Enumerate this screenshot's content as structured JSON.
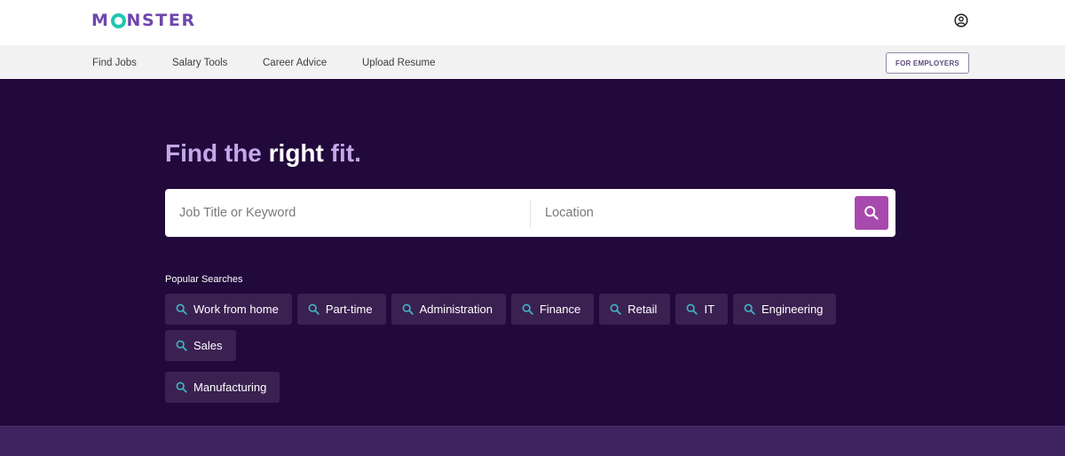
{
  "header": {
    "logo": {
      "pre": "M",
      "post": "NSTER",
      "full": "MONSTER"
    },
    "user_icon": "user-circle-icon"
  },
  "nav": {
    "items": [
      {
        "label": "Find Jobs"
      },
      {
        "label": "Salary Tools"
      },
      {
        "label": "Career Advice"
      },
      {
        "label": "Upload Resume"
      }
    ],
    "employers_button": "FOR EMPLOYERS"
  },
  "hero": {
    "headline_part1": "Find the ",
    "headline_emphasis": "right",
    "headline_part2": " fit.",
    "search": {
      "keyword_placeholder": "Job Title or Keyword",
      "keyword_value": "",
      "location_placeholder": "Location",
      "location_value": "",
      "button_icon": "search-icon"
    },
    "popular_label": "Popular Searches",
    "popular_searches": [
      {
        "label": "Work from home"
      },
      {
        "label": "Part-time"
      },
      {
        "label": "Administration"
      },
      {
        "label": "Finance"
      },
      {
        "label": "Retail"
      },
      {
        "label": "IT"
      },
      {
        "label": "Engineering"
      },
      {
        "label": "Sales"
      },
      {
        "label": "Manufacturing"
      }
    ]
  },
  "colors": {
    "brand_purple": "#6e46ae",
    "brand_teal": "#22c6b0",
    "hero_bg": "#21093b",
    "chip_bg": "#3b2151",
    "search_button": "#a84aad",
    "headline": "#c3a8e8",
    "bottom_band": "#3d2461"
  }
}
